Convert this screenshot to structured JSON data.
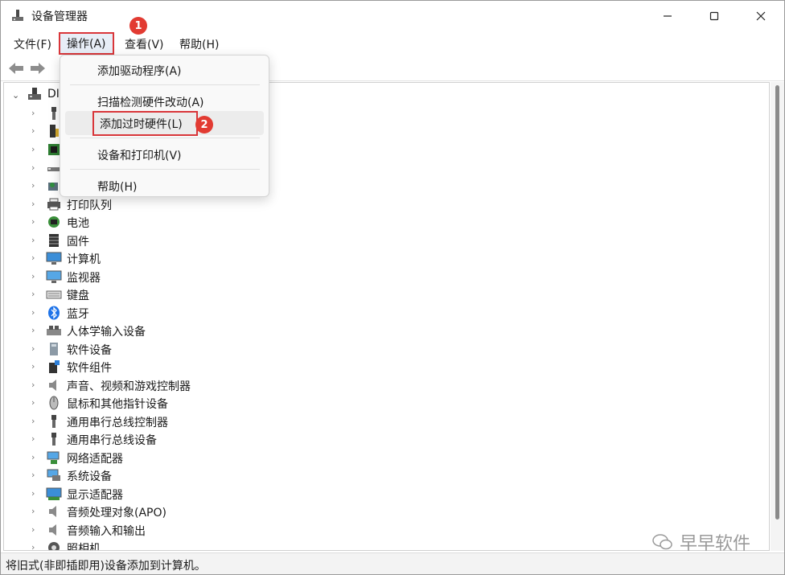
{
  "window": {
    "title": "设备管理器"
  },
  "menubar": {
    "file": "文件(F)",
    "action": "操作(A)",
    "view": "查看(V)",
    "help": "帮助(H)"
  },
  "tree": {
    "root_label": "DI",
    "items": [
      {
        "label": "",
        "icon": "usb-icon"
      },
      {
        "label": "",
        "icon": "device-icon"
      },
      {
        "label": "",
        "icon": "chip-icon"
      },
      {
        "label": "",
        "icon": "drive-icon"
      },
      {
        "label": "",
        "icon": "controller-icon"
      },
      {
        "label": "打印队列",
        "icon": "printer-icon"
      },
      {
        "label": "电池",
        "icon": "battery-icon"
      },
      {
        "label": "固件",
        "icon": "firmware-icon"
      },
      {
        "label": "计算机",
        "icon": "computer-icon"
      },
      {
        "label": "监视器",
        "icon": "monitor-icon"
      },
      {
        "label": "键盘",
        "icon": "keyboard-icon"
      },
      {
        "label": "蓝牙",
        "icon": "bluetooth-icon"
      },
      {
        "label": "人体学输入设备",
        "icon": "hid-icon"
      },
      {
        "label": "软件设备",
        "icon": "software-device-icon"
      },
      {
        "label": "软件组件",
        "icon": "software-component-icon"
      },
      {
        "label": "声音、视频和游戏控制器",
        "icon": "speaker-icon"
      },
      {
        "label": "鼠标和其他指针设备",
        "icon": "mouse-icon"
      },
      {
        "label": "通用串行总线控制器",
        "icon": "usb-icon"
      },
      {
        "label": "通用串行总线设备",
        "icon": "usb-icon"
      },
      {
        "label": "网络适配器",
        "icon": "network-icon"
      },
      {
        "label": "系统设备",
        "icon": "system-device-icon"
      },
      {
        "label": "显示适配器",
        "icon": "display-adapter-icon"
      },
      {
        "label": "音频处理对象(APO)",
        "icon": "speaker-icon"
      },
      {
        "label": "音频输入和输出",
        "icon": "speaker-icon"
      },
      {
        "label": "照相机",
        "icon": "camera-icon"
      }
    ]
  },
  "dropdown": {
    "add_driver": "添加驱动程序(A)",
    "scan": "扫描检测硬件改动(A)",
    "add_legacy": "添加过时硬件(L)",
    "devices_printers": "设备和打印机(V)",
    "help": "帮助(H)"
  },
  "callouts": {
    "one": "1",
    "two": "2"
  },
  "statusbar": {
    "text": "将旧式(非即插即用)设备添加到计算机。"
  },
  "watermark": {
    "text": "早早软件"
  },
  "colors": {
    "callout": "#e23b32",
    "highlight_border": "#d9363a",
    "bluetooth": "#1e73e8"
  }
}
